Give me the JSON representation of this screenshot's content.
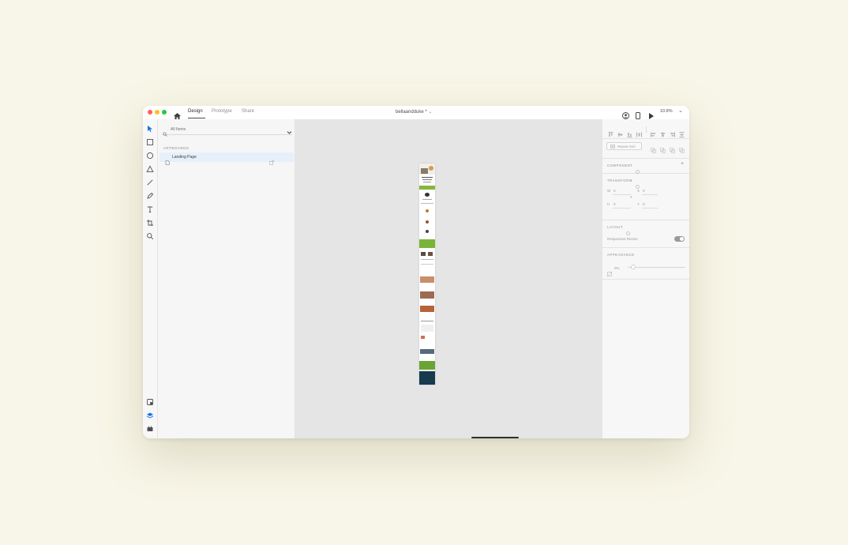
{
  "titlebar": {
    "tabs": [
      {
        "label": "Design"
      },
      {
        "label": "Prototype"
      },
      {
        "label": "Share"
      }
    ],
    "doc_title": "bellaandduke *",
    "zoom": "10.8%",
    "traffic_lights": {
      "close": "#ff5f57",
      "minimize": "#febc2e",
      "maximize": "#28c840"
    }
  },
  "toolbar": {
    "tools": [
      "select-tool",
      "rectangle-tool",
      "ellipse-tool",
      "polygon-tool",
      "line-tool",
      "pen-tool",
      "text-tool",
      "artboard-tool",
      "zoom-tool"
    ],
    "bottom": [
      "assets-panel-icon",
      "layers-panel-icon",
      "plugins-panel-icon"
    ]
  },
  "layers": {
    "search_placeholder": "All Items",
    "section_label": "ARTBOARDS",
    "items": [
      {
        "label": "Landing Page"
      }
    ]
  },
  "inspector": {
    "repeat_grid_label": "Repeat Grid",
    "component_title": "COMPONENT",
    "transform_title": "TRANSFORM",
    "w_label": "W",
    "w_value": "0",
    "x_label": "X",
    "x_value": "0",
    "h_label": "H",
    "h_value": "0",
    "y_label": "Y",
    "y_value": "0",
    "layout_title": "LAYOUT",
    "responsive_label": "Responsive Resize",
    "responsive_on": true,
    "appearance_title": "APPEARANCE",
    "opacity": "0%"
  },
  "colors": {
    "background": "#f8f6e8",
    "accent": "#1473e6",
    "canvas": "#e5e5e5"
  }
}
